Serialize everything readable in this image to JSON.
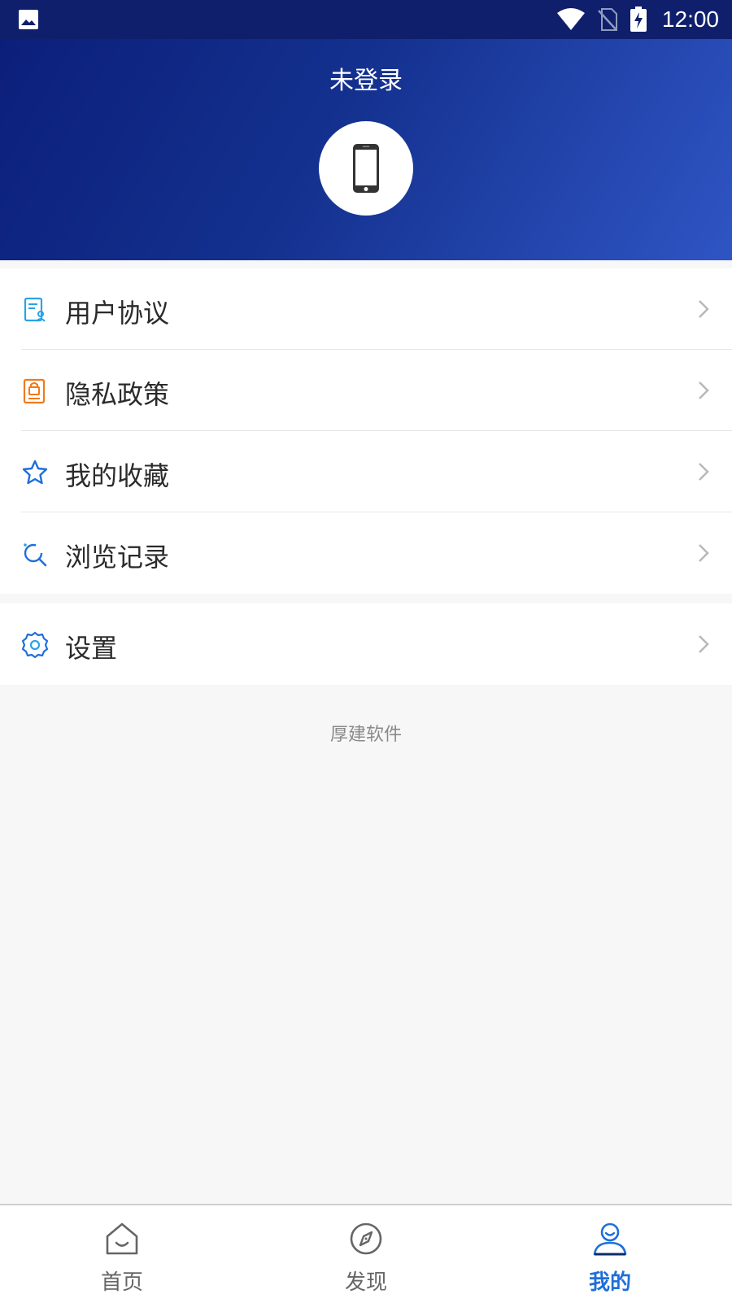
{
  "status_bar": {
    "time": "12:00",
    "icons": [
      "image-icon",
      "wifi-icon",
      "no-sim-icon",
      "battery-charging-icon"
    ]
  },
  "header": {
    "login_status": "未登录",
    "avatar_icon": "phone-icon"
  },
  "menu": {
    "group1": [
      {
        "label": "用户协议",
        "icon": "document-user-icon",
        "color": "#2aa3e6"
      },
      {
        "label": "隐私政策",
        "icon": "lock-document-icon",
        "color": "#f07a1a"
      },
      {
        "label": "我的收藏",
        "icon": "star-icon",
        "color": "#1e6fd9"
      },
      {
        "label": "浏览记录",
        "icon": "history-icon",
        "color": "#1e6fd9"
      }
    ],
    "group2": [
      {
        "label": "设置",
        "icon": "gear-icon",
        "color": "#1e6fd9"
      }
    ]
  },
  "footer_note": "厚建软件",
  "tabs": [
    {
      "label": "首页",
      "icon": "home-icon",
      "active": false
    },
    {
      "label": "发现",
      "icon": "compass-icon",
      "active": false
    },
    {
      "label": "我的",
      "icon": "user-icon",
      "active": true
    }
  ],
  "colors": {
    "accent": "#1e6fd9",
    "inactive": "#666666",
    "header_start": "#0b1f7a",
    "header_end": "#2f55c4"
  }
}
